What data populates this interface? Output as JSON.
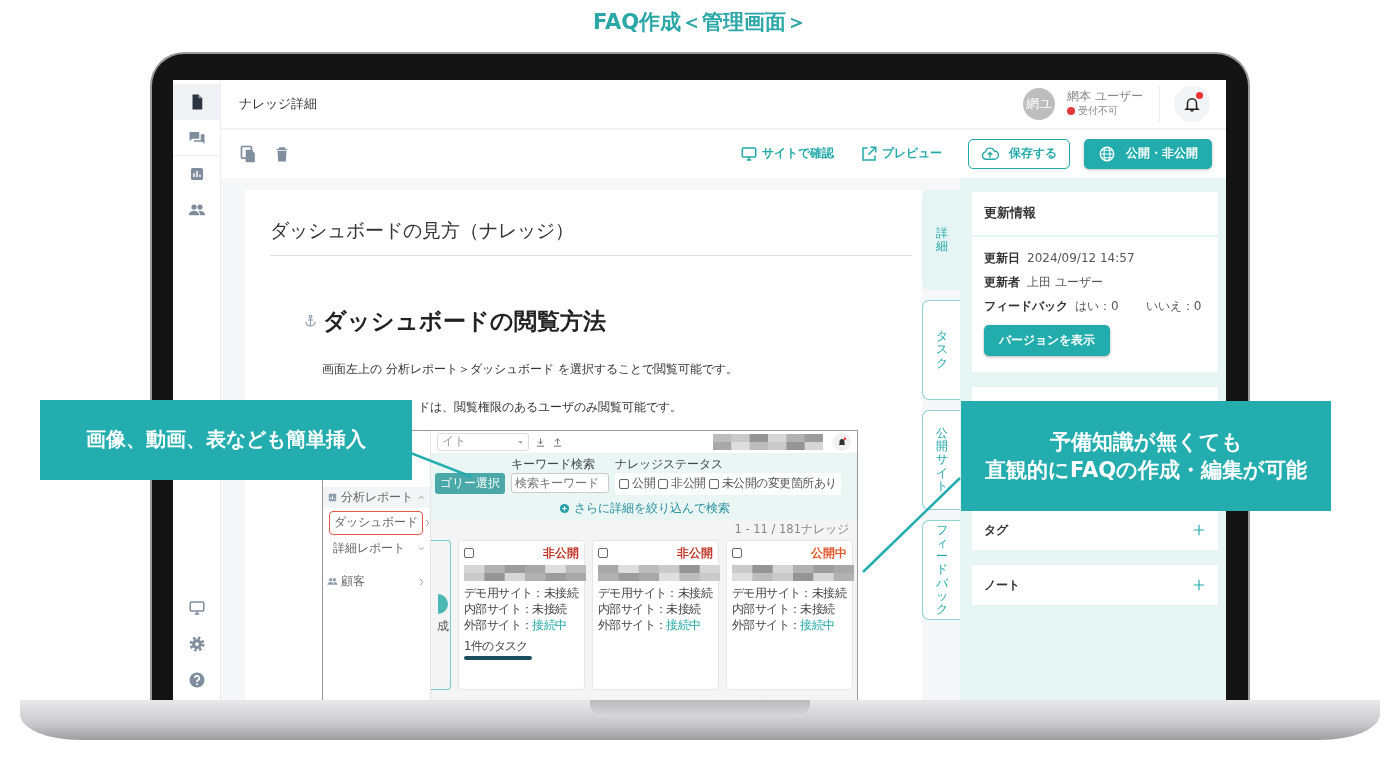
{
  "page_title": "FAQ作成＜管理画面＞",
  "rail": {
    "top": [
      {
        "kind": "file",
        "selected": true
      },
      {
        "kind": "chat",
        "selected": false
      },
      {
        "kind": "chart",
        "selected": false
      },
      {
        "kind": "people",
        "selected": false
      }
    ],
    "bottom": [
      {
        "kind": "monitor",
        "selected": false
      },
      {
        "kind": "gear",
        "selected": false
      },
      {
        "kind": "help",
        "selected": false
      }
    ]
  },
  "header": {
    "title": "ナレッジ詳細",
    "user": {
      "initials": "網ユ",
      "name": "網本 ユーザー",
      "status": "受付不可"
    },
    "notification": {
      "unread": true
    }
  },
  "toolbar": {
    "actions": [
      {
        "kind": "link",
        "label": "サイトで確認"
      },
      {
        "kind": "link",
        "label": "プレビュー"
      },
      {
        "kind": "outline",
        "label": "保存する"
      },
      {
        "kind": "primary",
        "label": "公開・非公開"
      }
    ]
  },
  "article": {
    "title": "ダッシュボードの見方（ナレッジ）",
    "heading": "ダッシュボードの閲覧方法",
    "paragraphs": [
      "画面左上の 分析レポート＞ダッシュボード を選択することで閲覧可能です。",
      "ドは、閲覧権限のあるユーザのみ閲覧可能です。"
    ],
    "embedded": {
      "site_select": "イト",
      "sidebar": [
        {
          "label": "分析レポート",
          "expanded": true,
          "children": [
            {
              "label": "ダッシュボード",
              "selected": true
            },
            {
              "label": "詳細レポート",
              "expanded": false,
              "selected": false
            }
          ]
        },
        {
          "label": "顧客"
        }
      ],
      "category_button": "ゴリー選択",
      "keyword_label": "キーワード検索",
      "keyword_placeholder": "検索キーワード",
      "status_label": "ナレッジステータス",
      "status_options": [
        {
          "label": "公開",
          "checked": false
        },
        {
          "label": "非公開",
          "checked": false
        },
        {
          "label": "未公開の変更箇所あり",
          "checked": false
        }
      ],
      "more_filters": "さらに詳細を絞り込んで検索",
      "count": "1 - 11 / 181ナレッジ",
      "partial_card_text": "成",
      "cards": [
        {
          "checked": false,
          "status": "非公開",
          "color": "#c0392b",
          "lines": [
            {
              "label": "デモ用サイト：",
              "value": "未接続",
              "connected": false
            },
            {
              "label": "内部サイト：",
              "value": "未接続",
              "connected": false
            },
            {
              "label": "外部サイト：",
              "value": "接続中",
              "connected": true
            }
          ],
          "task": {
            "label": "1件のタスク"
          }
        },
        {
          "checked": false,
          "status": "非公開",
          "color": "#c0392b",
          "lines": [
            {
              "label": "デモ用サイト：",
              "value": "未接続",
              "connected": false
            },
            {
              "label": "内部サイト：",
              "value": "未接続",
              "connected": false
            },
            {
              "label": "外部サイト：",
              "value": "接続中",
              "connected": true
            }
          ]
        },
        {
          "checked": false,
          "status": "公開中",
          "color": "#e0562a",
          "lines": [
            {
              "label": "デモ用サイト：",
              "value": "未接続",
              "connected": false
            },
            {
              "label": "内部サイト：",
              "value": "未接続",
              "connected": false
            },
            {
              "label": "外部サイト：",
              "value": "接続中",
              "connected": true
            }
          ]
        }
      ]
    }
  },
  "side_tabs": [
    {
      "label": "詳細",
      "selected": true
    },
    {
      "label": "タスク",
      "selected": false
    },
    {
      "label": "公開サイト",
      "selected": false
    },
    {
      "label": "フィードバック",
      "selected": false
    }
  ],
  "update_card": {
    "title": "更新情報",
    "rows": [
      {
        "label": "更新日",
        "values": [
          "2024/09/12 14:57"
        ]
      },
      {
        "label": "更新者",
        "values": [
          "上田 ユーザー"
        ]
      },
      {
        "label": "フィードバック",
        "values": [
          "はい：0",
          "いいえ：0"
        ]
      }
    ],
    "button": "バージョンを表示"
  },
  "sections": [
    {
      "title": "タグ"
    },
    {
      "title": "ノート"
    }
  ],
  "callouts": [
    {
      "lines": [
        "画像、動画、表なども簡単挿入"
      ]
    },
    {
      "lines": [
        "予備知識が無くても",
        "直観的にFAQの作成・編集が可能"
      ]
    }
  ]
}
